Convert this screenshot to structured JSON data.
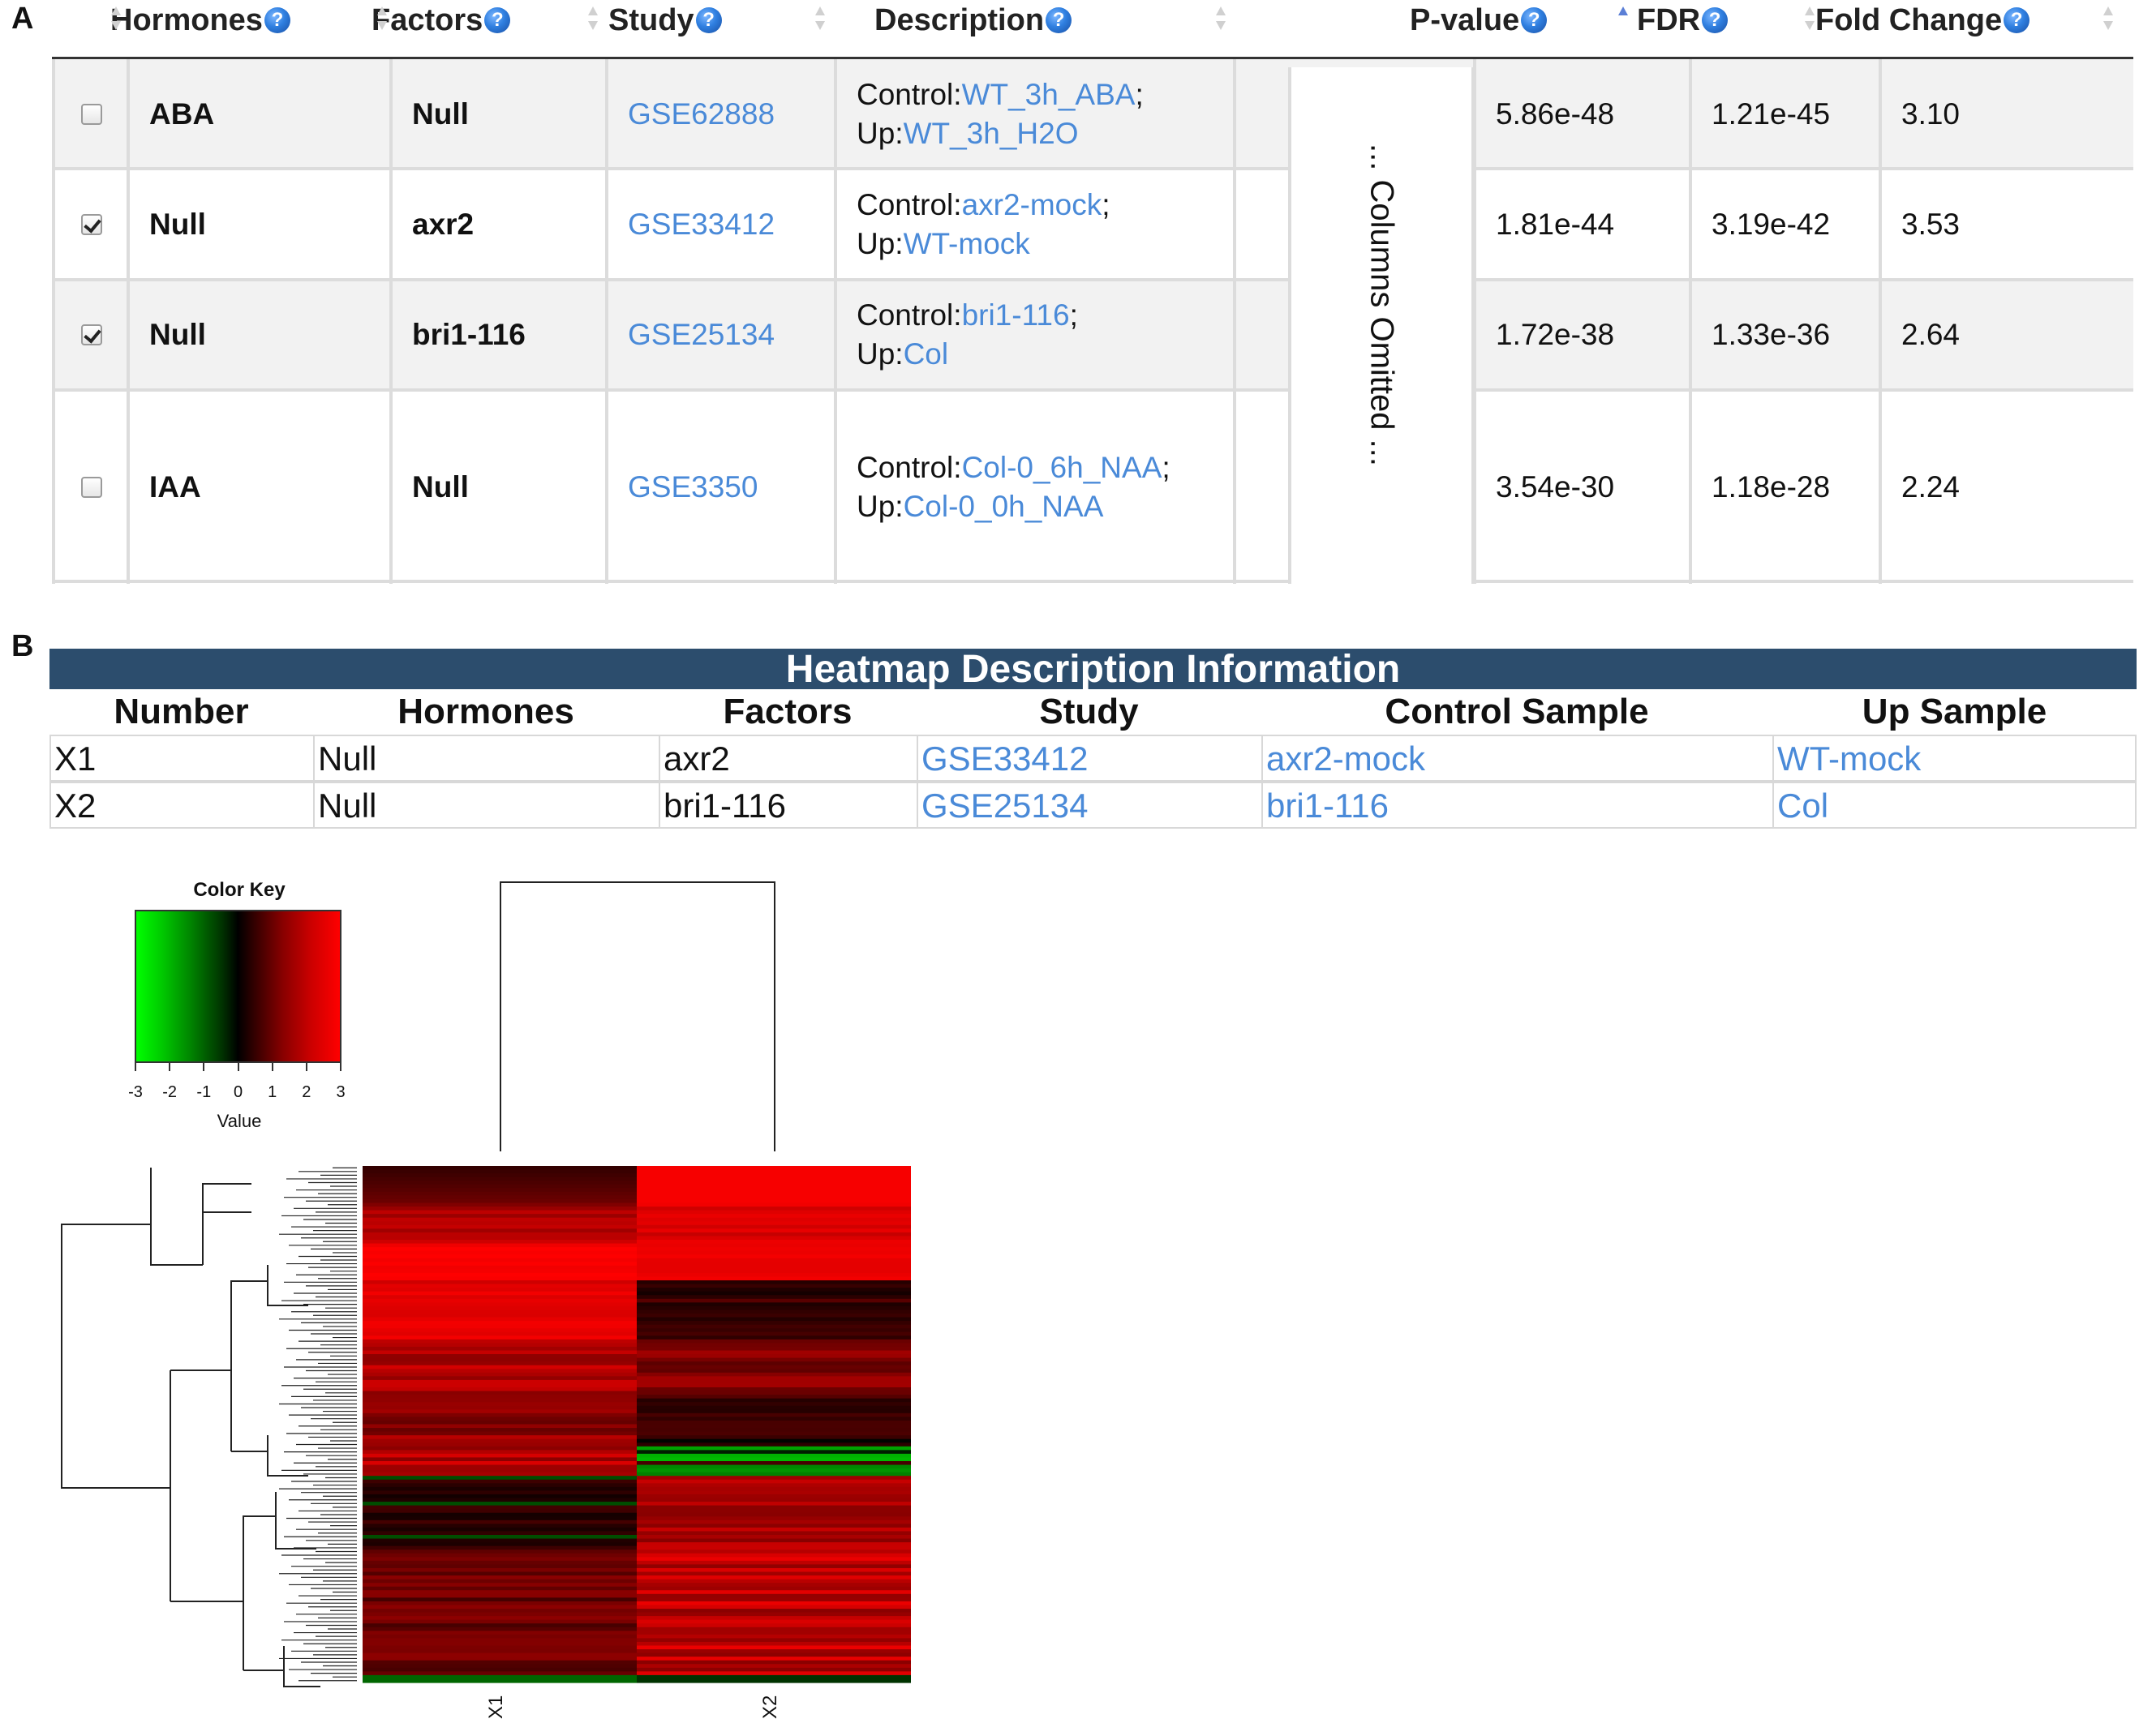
{
  "panels": {
    "a": "A",
    "b": "B"
  },
  "panelA": {
    "columns": [
      {
        "name": "col-hormones",
        "label": "Hormones",
        "help": true
      },
      {
        "name": "col-factors",
        "label": "Factors",
        "help": true
      },
      {
        "name": "col-study",
        "label": "Study",
        "help": true
      },
      {
        "name": "col-description",
        "label": "Description",
        "help": true
      },
      {
        "name": "col-pvalue",
        "label": "P-value",
        "help": true,
        "sort": "asc"
      },
      {
        "name": "col-fdr",
        "label": "FDR",
        "help": true
      },
      {
        "name": "col-foldchange",
        "label": "Fold Change",
        "help": true
      }
    ],
    "help_glyph": "?",
    "omitted_text": "... Columns Omitted ...",
    "rows": [
      {
        "checked": false,
        "hormone": "ABA",
        "factor": "Null",
        "study": "GSE62888",
        "control_prefix": "Control:",
        "control": "WT_3h_ABA",
        "up_prefix": "Up:",
        "up": "WT_3h_H2O",
        "pvalue": "5.86e-48",
        "fdr": "1.21e-45",
        "fold": "3.10"
      },
      {
        "checked": true,
        "hormone": "Null",
        "factor": "axr2",
        "study": "GSE33412",
        "control_prefix": "Control:",
        "control": "axr2-mock",
        "up_prefix": "Up:",
        "up": "WT-mock",
        "pvalue": "1.81e-44",
        "fdr": "3.19e-42",
        "fold": "3.53"
      },
      {
        "checked": true,
        "hormone": "Null",
        "factor": "bri1-116",
        "study": "GSE25134",
        "control_prefix": "Control:",
        "control": "bri1-116",
        "up_prefix": "Up:",
        "up": "Col",
        "pvalue": "1.72e-38",
        "fdr": "1.33e-36",
        "fold": "2.64"
      },
      {
        "checked": false,
        "hormone": "IAA",
        "factor": "Null",
        "study": "GSE3350",
        "control_prefix": "Control:",
        "control": "Col-0_6h_NAA",
        "up_prefix": "Up:",
        "up": "Col-0_0h_NAA",
        "pvalue": "3.54e-30",
        "fdr": "1.18e-28",
        "fold": "2.24"
      }
    ]
  },
  "panelB": {
    "title": "Heatmap Description Information",
    "headers": [
      "Number",
      "Hormones",
      "Factors",
      "Study",
      "Control Sample",
      "Up Sample"
    ],
    "rows": [
      {
        "number": "X1",
        "hormone": "Null",
        "factor": "axr2",
        "study": "GSE33412",
        "control": "axr2-mock",
        "up": "WT-mock"
      },
      {
        "number": "X2",
        "hormone": "Null",
        "factor": "bri1-116",
        "study": "GSE25134",
        "control": "bri1-116",
        "up": "Col"
      }
    ]
  },
  "heatmap": {
    "color_key_title": "Color Key",
    "color_key_xlabel": "Value",
    "color_key_ticks": [
      "-3",
      "-2",
      "-1",
      "0",
      "1",
      "2",
      "3"
    ],
    "colors": {
      "low": "#00ff00",
      "mid": "#000000",
      "high": "#ff0000"
    },
    "columns": [
      "X1",
      "X2"
    ]
  }
}
